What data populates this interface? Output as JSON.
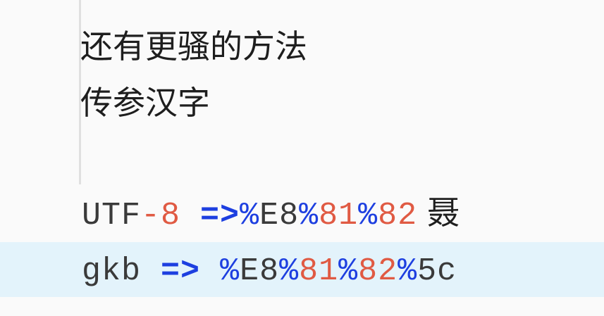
{
  "heading": {
    "line1": "还有更骚的方法",
    "line2": "传参汉字"
  },
  "code_lines": [
    {
      "segments": [
        {
          "text": "UTF",
          "color": "plain"
        },
        {
          "text": "-8",
          "color": "red"
        },
        {
          "text": " ",
          "color": "plain"
        },
        {
          "text": "=>",
          "color": "arrow"
        },
        {
          "text": "%",
          "color": "blue"
        },
        {
          "text": "E8",
          "color": "plain"
        },
        {
          "text": "%",
          "color": "blue"
        },
        {
          "text": "81",
          "color": "red"
        },
        {
          "text": "%",
          "color": "blue"
        },
        {
          "text": "82",
          "color": "red"
        }
      ],
      "trailing_char": "聂",
      "highlighted": false
    },
    {
      "segments": [
        {
          "text": "gkb",
          "color": "plain"
        },
        {
          "text": " ",
          "color": "plain"
        },
        {
          "text": "=>",
          "color": "arrow"
        },
        {
          "text": " ",
          "color": "plain"
        },
        {
          "text": "%",
          "color": "blue"
        },
        {
          "text": "E8",
          "color": "plain"
        },
        {
          "text": "%",
          "color": "blue"
        },
        {
          "text": "81",
          "color": "red"
        },
        {
          "text": "%",
          "color": "blue"
        },
        {
          "text": "82",
          "color": "red"
        },
        {
          "text": "%",
          "color": "blue"
        },
        {
          "text": "5c",
          "color": "plain"
        }
      ],
      "trailing_char": "",
      "highlighted": true
    }
  ],
  "colors": {
    "background": "#fafafa",
    "highlight_row": "#e3f3fb",
    "text": "#1e1e1e",
    "code_plain": "#3a3a3a",
    "code_red": "#e05a43",
    "code_blue": "#1d3fe0"
  }
}
